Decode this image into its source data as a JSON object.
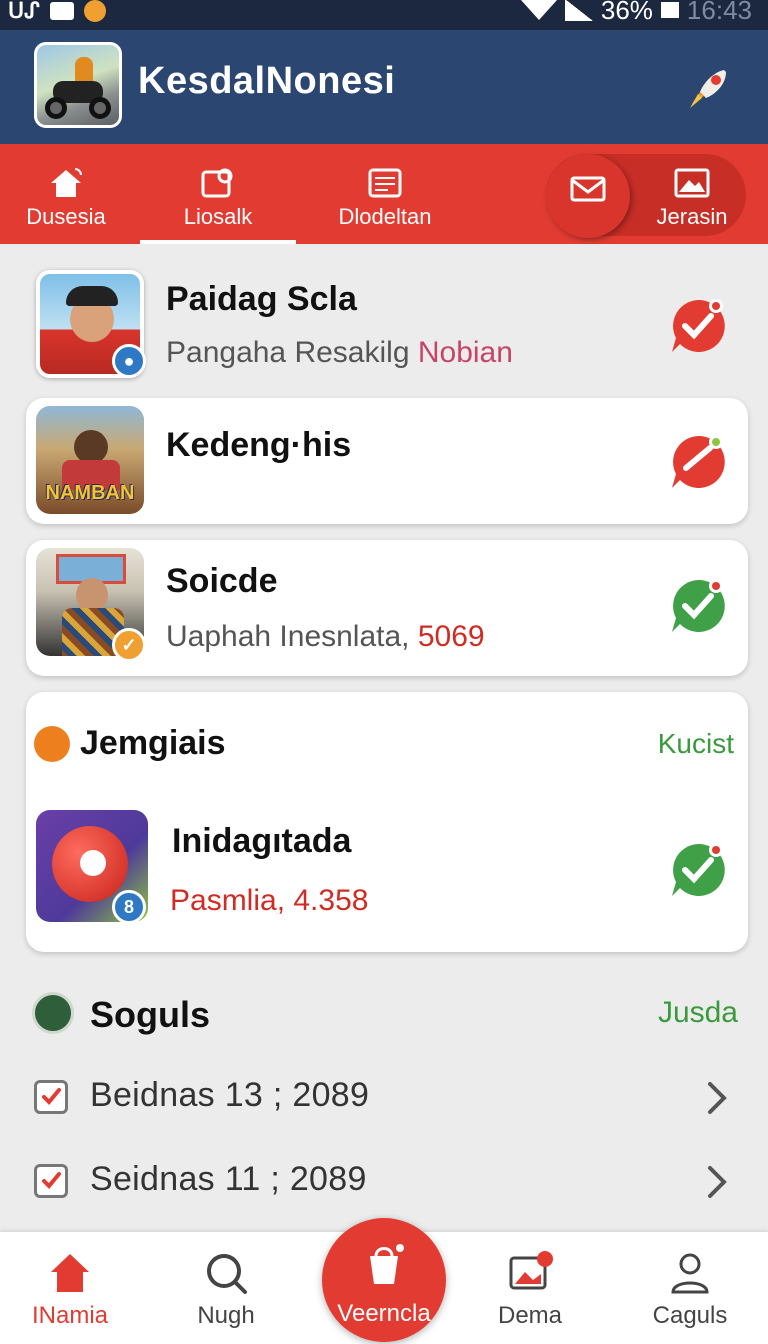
{
  "status_bar": {
    "left_text": "ᑌᔑ",
    "battery": "36%",
    "time": "16:43"
  },
  "header": {
    "title": "KesdalNonesi"
  },
  "tabs": [
    {
      "label": "Dusesia",
      "icon": "home-icon"
    },
    {
      "label": "Liosalk",
      "icon": "tag-icon",
      "selected": true
    },
    {
      "label": "Dlodeltan",
      "icon": "receipt-icon"
    },
    {
      "label": "",
      "icon": "mail-icon"
    },
    {
      "label": "Jerasin",
      "icon": "image-icon"
    }
  ],
  "items": [
    {
      "title": "Paidag Scla",
      "subtitle": "Pangaha Resakilg",
      "subtitle_highlight": "Nobian",
      "check_color": "#e23c32"
    },
    {
      "title": "Kedeng·his",
      "subtitle": "",
      "check_color": "#e23c32",
      "thumb_text": "NAMBAN"
    },
    {
      "title": "Soicde",
      "subtitle": "Uaphah Inesnlata,",
      "subtitle_highlight": "5069",
      "check_color": "#3fa047"
    }
  ],
  "section": {
    "title": "Jemgiais",
    "link": "Kucist",
    "item_title": "Inidagıtada",
    "item_subtitle": "Pasmlia, 4.358",
    "badge": "8",
    "check_color": "#3fa047"
  },
  "soguls": {
    "title": "Soguls",
    "link": "Jusda",
    "rows": [
      "Beidnas 13 ; 2089",
      "Seidnas 11 ; 2089"
    ]
  },
  "bottom_nav": [
    {
      "label": "INamia",
      "icon": "home-icon",
      "active": true
    },
    {
      "label": "Nugh",
      "icon": "search-icon"
    },
    {
      "label": "Veerncla",
      "icon": "cart-icon"
    },
    {
      "label": "Dema",
      "icon": "photo-icon"
    },
    {
      "label": "Caguls",
      "icon": "user-icon"
    }
  ]
}
